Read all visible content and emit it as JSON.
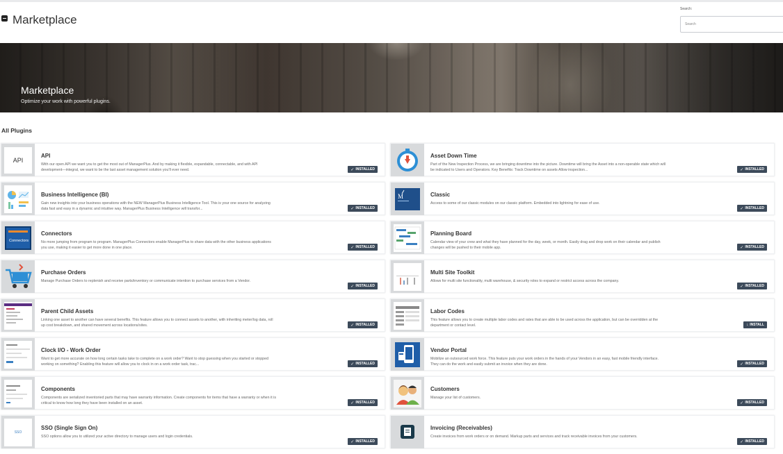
{
  "header": {
    "title": "Marketplace",
    "search_label": "Search:",
    "search_placeholder": "Search",
    "search_value": ""
  },
  "hero": {
    "title": "Marketplace",
    "subtitle": "Optimize your work with powerful plugins."
  },
  "section": {
    "title": "All Plugins"
  },
  "plugins": [
    {
      "name": "API",
      "desc": "With our open API we want you to get the most out of ManagerPlus. And by making it flexible, expandable, connectable, and with API development—integral, we want to be the last asset management solution you'll ever need.",
      "status": "INSTALLED",
      "icon": "api-icon"
    },
    {
      "name": "Asset Down Time",
      "desc": "Part of the New Inspection Process, we are bringing downtime into the picture. Downtime will bring the Asset into a non-operable state which will be indicated to Users and Operators. Key Benefits: Track Downtime on assets Allow inspection...",
      "status": "INSTALLED",
      "icon": "stopwatch-icon"
    },
    {
      "name": "Business Intelligence (BI)",
      "desc": "Gain new insights into your business operations with the NEW ManagerPlus Business Intelligence Tool. This is your one source for analyzing data fast and easy in a dynamic and intuitive way. ManagerPlus Business Intelligence will transfor...",
      "status": "INSTALLED",
      "icon": "charts-icon"
    },
    {
      "name": "Classic",
      "desc": "Access to some of our classic modules on our classic platform. Embedded into lightning for ease of use.",
      "status": "INSTALLED",
      "icon": "classic-logo-icon"
    },
    {
      "name": "Connectors",
      "desc": "No more jumping from program to program. ManagerPlus Connectors enable ManagerPlus to share data with the other business applications you use, making it easier to get more done in one place.",
      "status": "INSTALLED",
      "icon": "connectors-icon"
    },
    {
      "name": "Planning Board",
      "desc": "Calendar view of your crew and what they have planned for the day, week, or month. Easily drag and drop work on their calendar and publish changes will be pushed to their mobile app.",
      "status": "INSTALLED",
      "icon": "planning-board-icon"
    },
    {
      "name": "Purchase Orders",
      "desc": "Manage Purchase Orders to replenish and receive parts/inventory or communicate intention to purchase services from a Vendor.",
      "status": "INSTALLED",
      "icon": "shopping-cart-icon"
    },
    {
      "name": "Multi Site Toolkit",
      "desc": "Allows for multi site functionality, multi warehouse, & security roles to expand or restrict access across the company.",
      "status": "INSTALLED",
      "icon": "multi-site-icon"
    },
    {
      "name": "Parent Child Assets",
      "desc": "Linking one asset to another can have several benefits. This feature allows you to connect assets to another, with inheriting meter/log data, roll up cost breakdown, and shared movement across locations/sites.",
      "status": "INSTALLED",
      "icon": "parent-child-icon"
    },
    {
      "name": "Labor Codes",
      "desc": "This feature allows you to create multiple labor codes and rates that are able to be used across the application, but can be overridden at the department or contact level.",
      "status": "INSTALL",
      "icon": "labor-codes-icon"
    },
    {
      "name": "Clock I/O - Work Order",
      "desc": "Want to get more accurate on how long certain tasks take to complete on a work order? Want to stop guessing when you started or stopped working on something? Enabling this feature will allow you to clock in on a work order task, trac...",
      "status": "INSTALLED",
      "icon": "clock-io-icon"
    },
    {
      "name": "Vendor Portal",
      "desc": "Mobilize an outsourced work force. This feature puts your work orders in the hands of your Vendors in an easy, fast mobile friendly interface. They can do the work and easily submit an invoice when they are done.",
      "status": "INSTALLED",
      "icon": "vendor-portal-icon"
    },
    {
      "name": "Components",
      "desc": "Components are serialized inventoried parts that may have warranty information. Create components for items that have a warranty or when it is critical to know how long they have been installed on an asset.",
      "status": "INSTALLED",
      "icon": "components-icon"
    },
    {
      "name": "Customers",
      "desc": "Manage your list of customers.",
      "status": "INSTALLED",
      "icon": "customers-icon"
    },
    {
      "name": "SSO (Single Sign On)",
      "desc": "SSO options allow you to utilized your active directory to manage users and login credentials.",
      "status": "INSTALLED",
      "icon": "sso-icon"
    },
    {
      "name": "Invoicing (Receivables)",
      "desc": "Create invoices from work orders or on demand. Markup parts and services and track receivable invoices from your customers.",
      "status": "INSTALLED",
      "icon": "invoice-icon"
    }
  ],
  "thumb_text": {
    "api": "API",
    "connectors": "Connectors",
    "sso": "SSO"
  },
  "colors": {
    "badge": "#3c4a5a",
    "thumb_bg": "#d8dadc"
  }
}
